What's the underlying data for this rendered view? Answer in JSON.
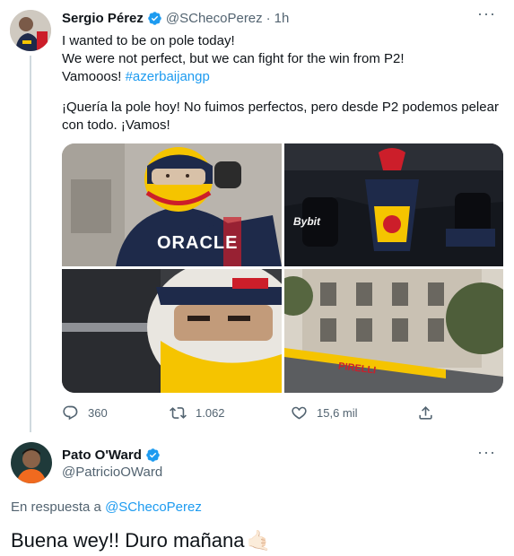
{
  "tweet": {
    "author_name": "Sergio Pérez",
    "handle": "@SChecoPerez",
    "separator": "·",
    "time": "1h",
    "more": "···",
    "lines": [
      "I wanted to be on pole today!",
      "We were not perfect, but we can fight for the win from P2!",
      "Vamooos! "
    ],
    "hashtag": "#azerbaijangp",
    "spanish_line1": "¡Quería la pole hoy! No fuimos perfectos, pero desde P2 podemos pelear",
    "spanish_line2": "con todo. ¡Vamos!",
    "media": [
      {
        "label": "ORACLE",
        "description": "driver-helmet"
      },
      {
        "label": "Bybit",
        "description": "car"
      },
      {
        "label": "",
        "description": "helmet-closeup"
      },
      {
        "label": "PIRELLI",
        "description": "track-buildings"
      }
    ],
    "actions": {
      "replies": "360",
      "retweets": "1.062",
      "likes": "15,6 mil"
    }
  },
  "reply": {
    "author_name": "Pato O'Ward",
    "handle": "@PatricioOWard",
    "more": "···",
    "replying_prefix": "En respuesta a ",
    "replying_to": "@SChecoPerez",
    "text": "Buena wey!! Duro mañana",
    "emoji": "🤙🏻"
  },
  "colors": {
    "link": "#1d9bf0",
    "muted": "#536471",
    "verified": "#1d9bf0",
    "redbull_navy": "#1e2a4a",
    "redbull_yellow": "#f5c400",
    "redbull_red": "#cc1e2a"
  }
}
